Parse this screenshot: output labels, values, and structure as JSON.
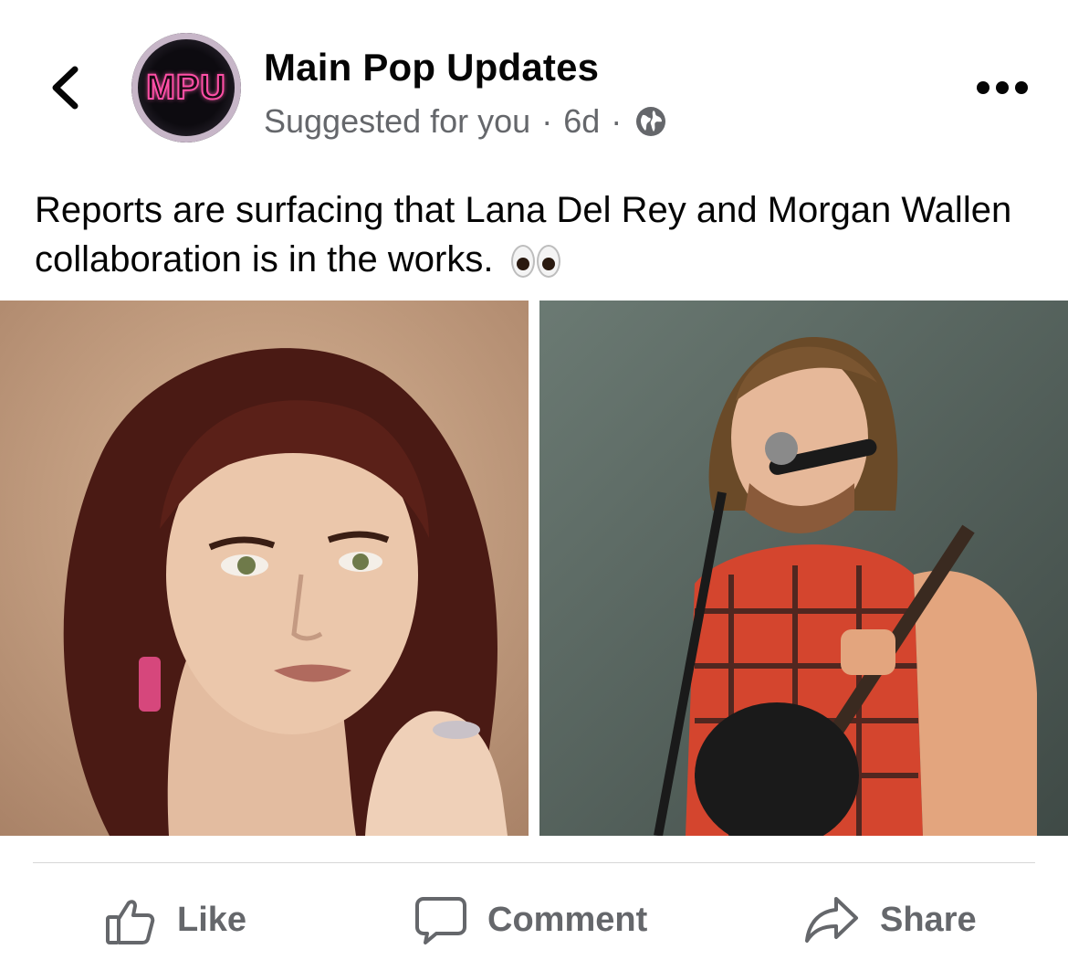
{
  "header": {
    "avatar_text": "MPU",
    "page_name": "Main Pop Updates",
    "suggested": "Suggested for you",
    "separator": "·",
    "age": "6d"
  },
  "post": {
    "text": "Reports are surfacing that Lana Del Rey and Morgan Wallen collaboration is in the works."
  },
  "actions": {
    "like_label": "Like",
    "comment_label": "Comment",
    "share_label": "Share"
  },
  "icons": {
    "back": "chevron-left-icon",
    "more": "more-horizontal-icon",
    "audience": "globe-icon",
    "emoji": "eyes-emoji-icon",
    "like": "thumbs-up-icon",
    "comment": "speech-bubble-icon",
    "share": "share-arrow-icon"
  },
  "colors": {
    "text_primary": "#050505",
    "text_secondary": "#65676b",
    "avatar_accent": "#ff4fa6"
  }
}
